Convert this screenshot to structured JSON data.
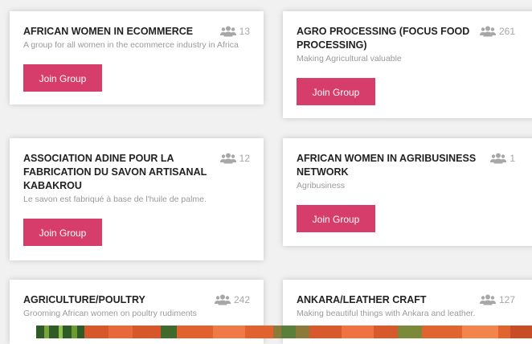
{
  "colors": {
    "accent": "#d63d6a",
    "title": "#222222",
    "muted": "#9a9a9a",
    "icon": "#a7a7a7"
  },
  "icons": {
    "members": "group-icon"
  },
  "groups": [
    {
      "title": "AFRICAN WOMEN IN ECOMMERCE",
      "description": "A group for all women in the ecommerce industry in Africa",
      "members": "13",
      "button_label": "Join Group"
    },
    {
      "title": "AGRO PROCESSING (FOCUS FOOD PROCESSING)",
      "description": "Making Agricultural valuable",
      "members": "261",
      "button_label": "Join Group"
    },
    {
      "title": "ASSOCIATION ADINE POUR LA FABRICATION DU SAVON ARTISANAL KABAKROU",
      "description": "Le savon est fabriqué à base de l'huile de palme.",
      "members": "12",
      "button_label": "Join Group"
    },
    {
      "title": "AFRICAN WOMEN IN AGRIBUSINESS NETWORK",
      "description": "Agribusiness",
      "members": "1",
      "button_label": "Join Group"
    },
    {
      "title": "AGRICULTURE/POULTRY",
      "description": "Grooming African women on poultry rudiments",
      "members": "242"
    },
    {
      "title": "ANKARA/LEATHER CRAFT",
      "description": "Making beautiful things with Ankara and leather.",
      "members": "127"
    }
  ]
}
